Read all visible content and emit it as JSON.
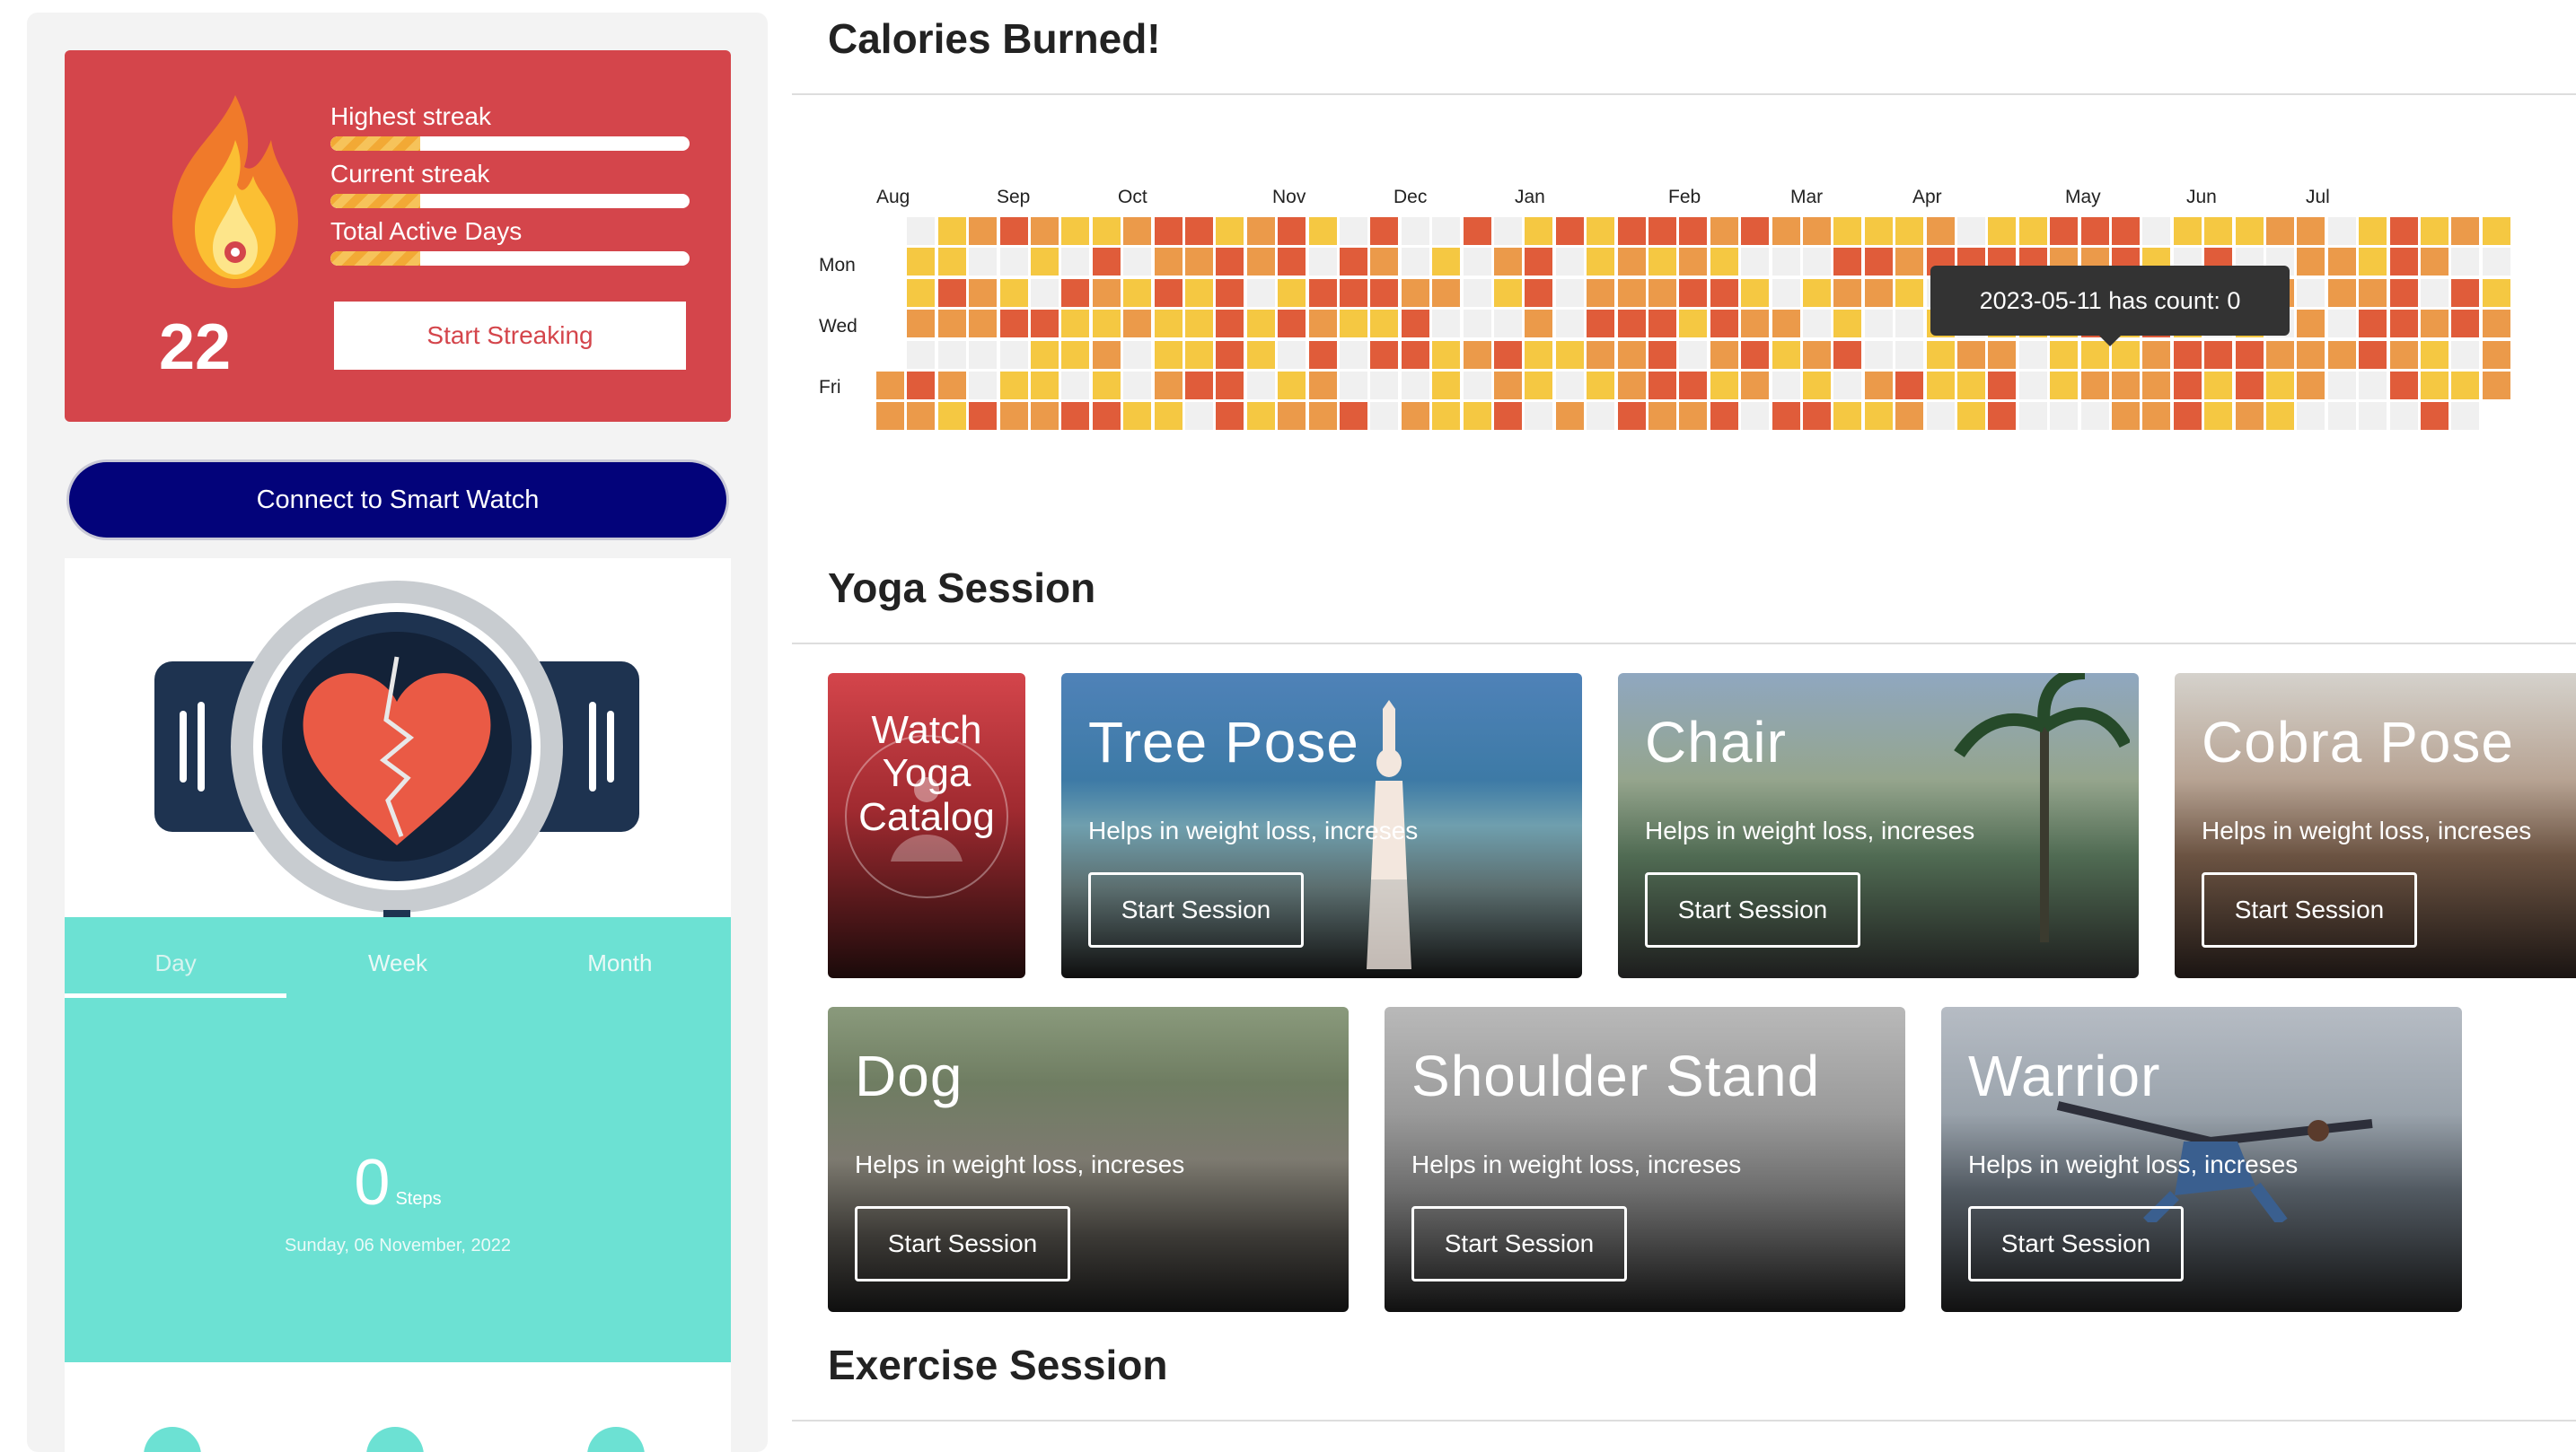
{
  "streak": {
    "number": "22",
    "stats": [
      {
        "label": "Highest streak",
        "fill": 0.25
      },
      {
        "label": "Current streak",
        "fill": 0.25
      },
      {
        "label": "Total Active Days",
        "fill": 0.25
      }
    ],
    "start_label": "Start Streaking"
  },
  "connect_label": "Connect to Smart Watch",
  "activity": {
    "tabs": [
      "Day",
      "Week",
      "Month"
    ],
    "active_tab": "Day",
    "steps_value": "0",
    "steps_unit": "Steps",
    "date": "Sunday, 06 November, 2022"
  },
  "calories": {
    "title": "Calories Burned!",
    "months": [
      "Aug",
      "Sep",
      "Oct",
      "Nov",
      "Dec",
      "Jan",
      "Feb",
      "Mar",
      "Apr",
      "May",
      "Jun",
      "Jul"
    ],
    "days": [
      "Mon",
      "Wed",
      "Fri"
    ],
    "tooltip": "2023-05-11 has count: 0",
    "colors": [
      "#f0f0f0",
      "#f5c842",
      "#eb9a4a",
      "#e05c3a"
    ]
  },
  "yoga": {
    "title": "Yoga Session",
    "catalog_label": "Watch Yoga Catalog",
    "cards": [
      {
        "name": "Tree Pose",
        "desc": "Helps in weight loss, increses",
        "btn": "Start Session"
      },
      {
        "name": "Chair",
        "desc": "Helps in weight loss, increses",
        "btn": "Start Session"
      },
      {
        "name": "Cobra Pose",
        "desc": "Helps in weight loss, increses",
        "btn": "Start Session"
      },
      {
        "name": "Dog",
        "desc": "Helps in weight loss, increses",
        "btn": "Start Session"
      },
      {
        "name": "Shoulder Stand",
        "desc": "Helps in weight loss, increses",
        "btn": "Start Session"
      },
      {
        "name": "Warrior",
        "desc": "Helps in weight loss, increses",
        "btn": "Start Session"
      }
    ]
  },
  "exercise": {
    "title": "Exercise Session"
  }
}
